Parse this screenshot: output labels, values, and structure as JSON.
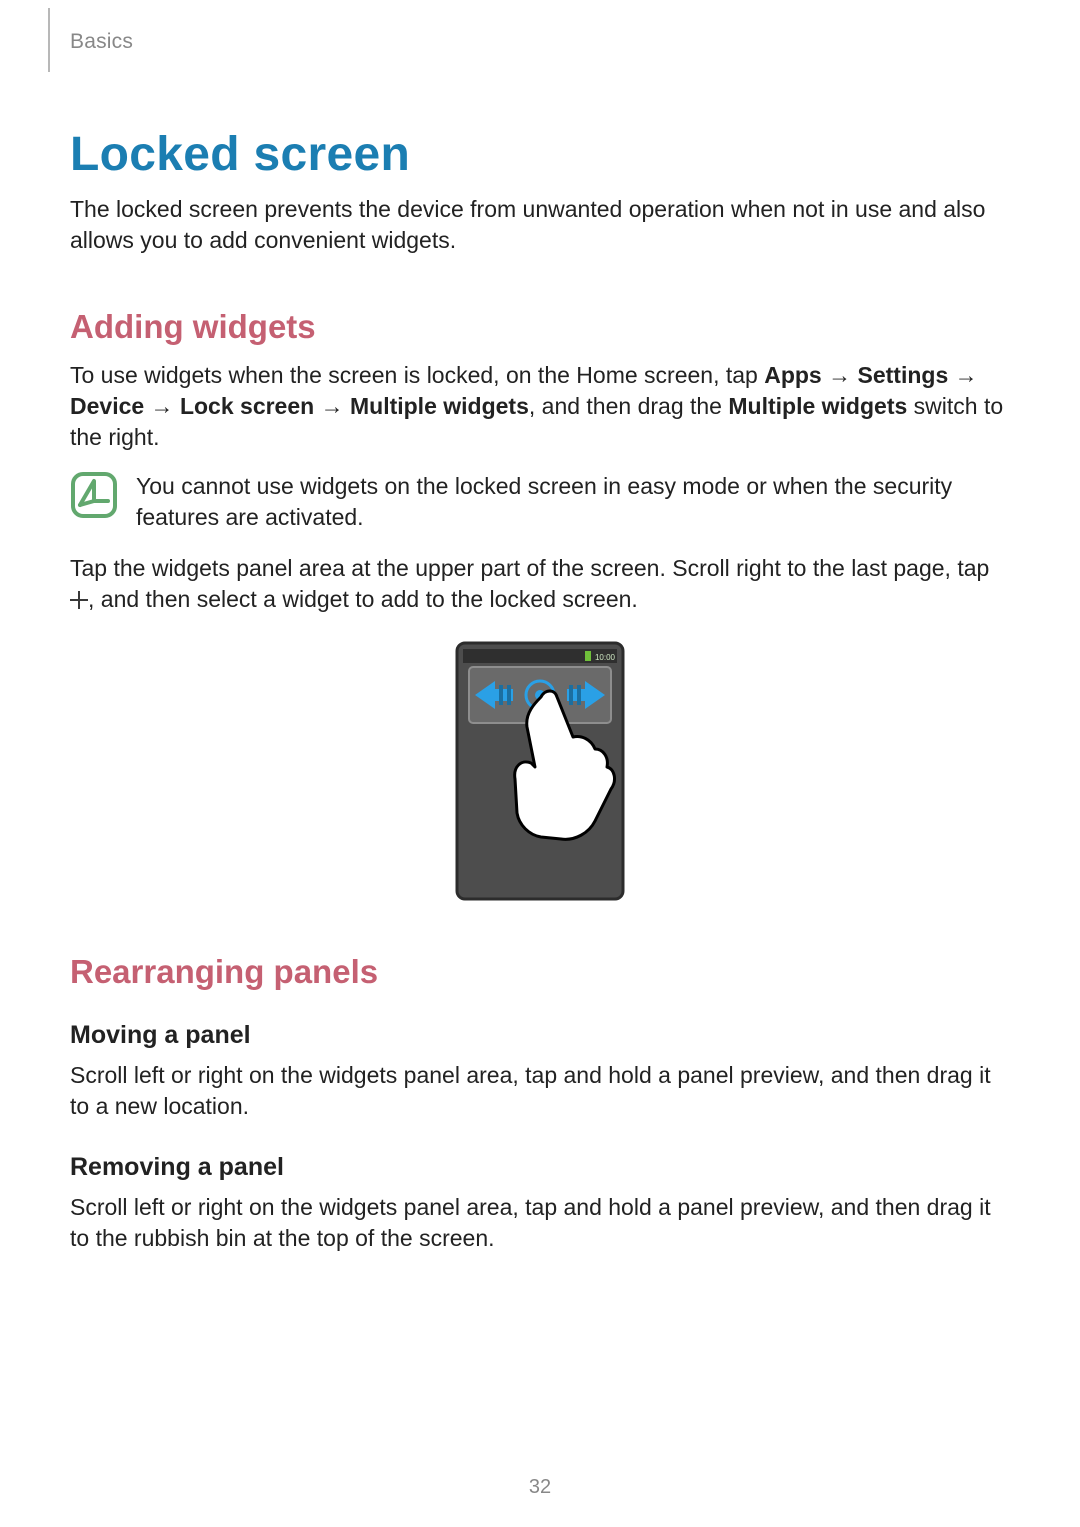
{
  "breadcrumb": "Basics",
  "title": "Locked screen",
  "intro": "The locked screen prevents the device from unwanted operation when not in use and also allows you to add convenient widgets.",
  "adding": {
    "heading": "Adding widgets",
    "para1_lead": "To use widgets when the screen is locked, on the Home screen, tap ",
    "apps": "Apps",
    "arrow": " → ",
    "settings": "Settings",
    "device": "Device",
    "lockscreen": "Lock screen",
    "multwidgets": "Multiple widgets",
    "para1_mid": ", and then drag the ",
    "multwidgets2": "Multiple widgets",
    "para1_tail": " switch to the right.",
    "note_text": "You cannot use widgets on the locked screen in easy mode or when the security features are activated.",
    "para2_lead": "Tap the widgets panel area at the upper part of the screen. Scroll right to the last page, tap ",
    "para2_tail": ", and then select a widget to add to the locked screen.",
    "figure_time": "10:00"
  },
  "rearranging": {
    "heading": "Rearranging panels",
    "moving_h": "Moving a panel",
    "moving_p": "Scroll left or right on the widgets panel area, tap and hold a panel preview, and then drag it to a new location.",
    "removing_h": "Removing a panel",
    "removing_p": "Scroll left or right on the widgets panel area, tap and hold a panel preview, and then drag it to the rubbish bin at the top of the screen."
  },
  "page_number": "32",
  "colors": {
    "title": "#1b7eb2",
    "subheading": "#c56072",
    "note_icon": "#62a86e"
  }
}
